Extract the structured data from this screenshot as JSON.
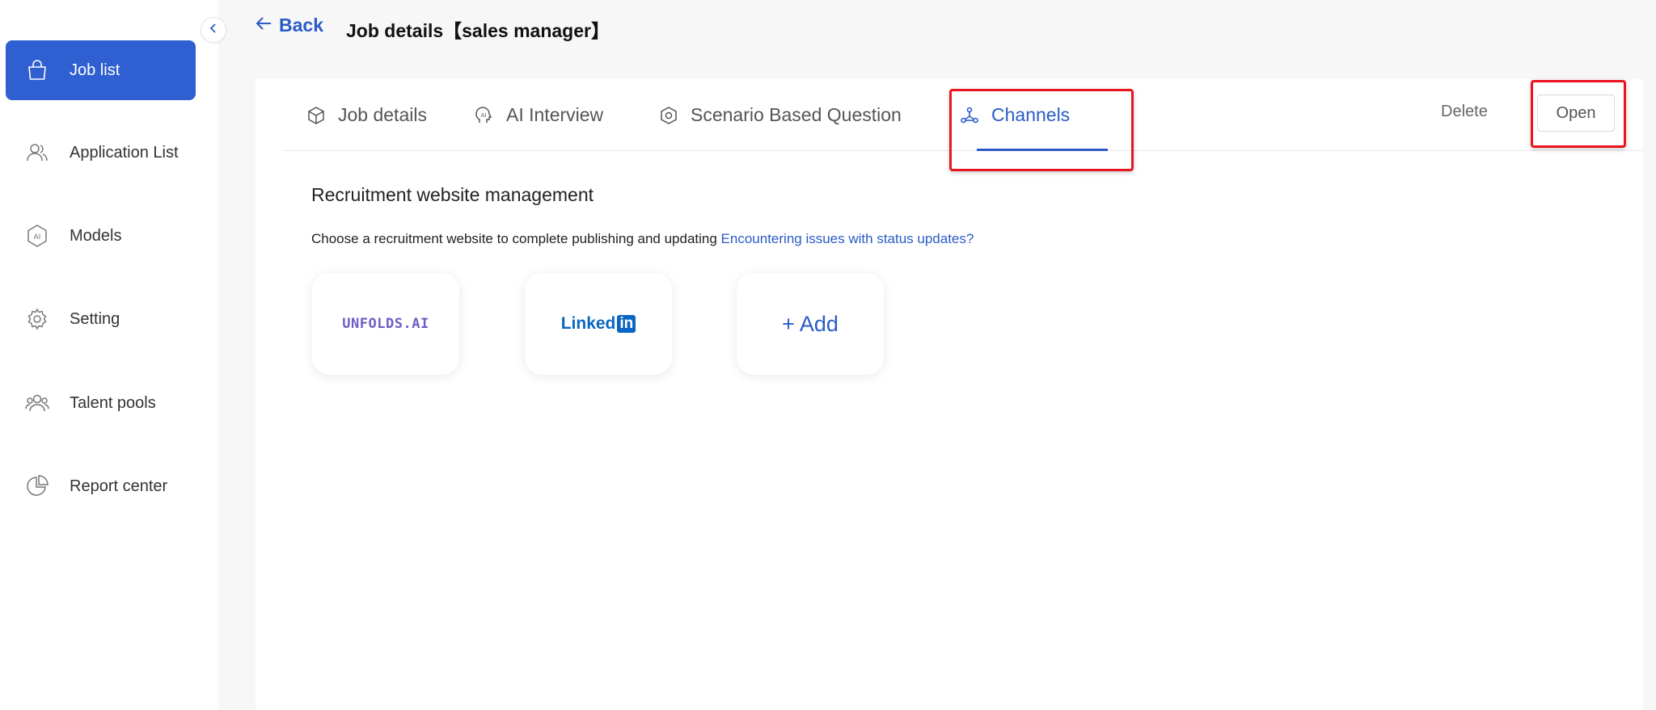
{
  "sidebar": {
    "items": [
      {
        "label": "Job list",
        "icon": "bag-icon",
        "active": true
      },
      {
        "label": "Application List",
        "icon": "users-icon"
      },
      {
        "label": "Models",
        "icon": "ai-icon"
      },
      {
        "label": "Setting",
        "icon": "gear-icon"
      },
      {
        "label": "Talent pools",
        "icon": "group-icon"
      },
      {
        "label": "Report center",
        "icon": "pie-chart-icon"
      }
    ]
  },
  "header": {
    "back_label": "Back",
    "title": "Job details【sales manager】"
  },
  "tabs": [
    {
      "label": "Job details",
      "icon": "cube-icon"
    },
    {
      "label": "AI Interview",
      "icon": "ai-head-icon"
    },
    {
      "label": "Scenario Based Question",
      "icon": "hexagon-icon"
    },
    {
      "label": "Channels",
      "icon": "channels-icon",
      "active": true
    }
  ],
  "actions": {
    "delete_label": "Delete",
    "open_label": "Open"
  },
  "content": {
    "title": "Recruitment website management",
    "description": "Choose a recruitment website to complete publishing and updating",
    "issue_link": "Encountering issues with status updates?",
    "channels": [
      {
        "logo_text": "UNFOLDS",
        "logo_dot": ".",
        "logo_suffix": "AI"
      },
      {
        "logo_text": "Linked",
        "logo_badge": "in"
      }
    ],
    "add_label": "+ Add"
  },
  "colors": {
    "accent": "#2a5bc7",
    "active_nav": "#2f5fd0",
    "highlight": "#e8141e"
  }
}
